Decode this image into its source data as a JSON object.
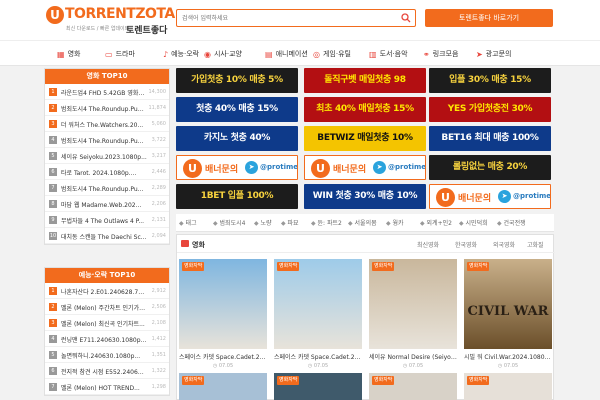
{
  "header": {
    "logo_mark": "U",
    "logo_text": "TORRENTZOTA",
    "logo_subtitle": "최신 다운로드 / 빠른 업데이트",
    "logo_korean": "토렌트좋다",
    "search_placeholder": "검색어 입력하세요",
    "cta_label": "토렌트좋다 바로가기"
  },
  "nav": [
    {
      "icon": "home-icon",
      "glyph": "▦",
      "label": "영화"
    },
    {
      "icon": "tv-icon",
      "glyph": "▭",
      "label": "드라마"
    },
    {
      "icon": "music-icon",
      "glyph": "♪",
      "label": "예능·오락"
    },
    {
      "icon": "camera-icon",
      "glyph": "◉",
      "label": "시사·교양"
    },
    {
      "icon": "list-icon",
      "glyph": "▤",
      "label": "애니메이션"
    },
    {
      "icon": "game-icon",
      "glyph": "◎",
      "label": "게임·유틸"
    },
    {
      "icon": "book-icon",
      "glyph": "▥",
      "label": "도서·음악"
    },
    {
      "icon": "link-icon",
      "glyph": "⚭",
      "label": "링크모음"
    },
    {
      "icon": "telegram-icon",
      "glyph": "➤",
      "label": "광고문의"
    }
  ],
  "sidebar_movies": {
    "title": "영화 TOP10",
    "items": [
      {
        "rank": "1",
        "title": "라운드업4 FHD 5.42GB 영화토렌트",
        "count": "14,300"
      },
      {
        "rank": "2",
        "title": "범죄도시4 The.Roundup.Pun...",
        "count": "11,874"
      },
      {
        "rank": "3",
        "title": "더 워처스 The.Watchers.20...",
        "count": "5,060"
      },
      {
        "rank": "4",
        "title": "범죄도시4 The.Roundup.Pu...",
        "count": "3,722"
      },
      {
        "rank": "5",
        "title": "세이유 Seiyoku.2023.1080p...",
        "count": "3,217"
      },
      {
        "rank": "6",
        "title": "타로 Tarot. 2024.1080p....",
        "count": "2,446"
      },
      {
        "rank": "7",
        "title": "범죄도시4 The.Roundup.Pu...",
        "count": "2,289"
      },
      {
        "rank": "8",
        "title": "마담 웹 Madame.Web.202...",
        "count": "2,206"
      },
      {
        "rank": "9",
        "title": "무법자들 4 The Outlaws 4 P...",
        "count": "2,131"
      },
      {
        "rank": "10",
        "title": "대치동 스캔들 The Daechi Sc...",
        "count": "2,094"
      }
    ]
  },
  "sidebar_shows": {
    "title": "예능·오락 TOP10",
    "items": [
      {
        "rank": "1",
        "title": "나혼자산다 2.E01.240628.72...",
        "count": "2,912"
      },
      {
        "rank": "2",
        "title": "멜론 (Melon) 주간차트 인기가요...",
        "count": "2,506"
      },
      {
        "rank": "3",
        "title": "멜론 (Melon) 최신곡 인기차트...",
        "count": "2,108"
      },
      {
        "rank": "4",
        "title": "런닝맨 E711.240630.1080p...",
        "count": "1,412"
      },
      {
        "rank": "5",
        "title": "놀면뭐하니.240630.1080p...",
        "count": "1,351"
      },
      {
        "rank": "6",
        "title": "전지적 참견 시점 E552.240628.7...",
        "count": "1,322"
      },
      {
        "rank": "7",
        "title": "멜론 (Melon) HOT TREND...",
        "count": "1,298"
      }
    ]
  },
  "banners": [
    {
      "style": "bn-dark",
      "text": "가입첫충 10% 매충 5%"
    },
    {
      "style": "bn-red",
      "text": "돌직구벳 매일첫충 98"
    },
    {
      "style": "bn-dark",
      "text": "입플 30% 매충 15%"
    },
    {
      "style": "bn-blue",
      "text": "첫충 40% 매충 15%"
    },
    {
      "style": "bn-red",
      "text": "최초 40% 매일첫충 15%"
    },
    {
      "style": "bn-red",
      "text": "YES 가입첫충전 30%"
    },
    {
      "style": "bn-blue",
      "text": "카지노 첫충 40%"
    },
    {
      "style": "bn-yellow",
      "text": "BETWIZ 매일첫충 10%"
    },
    {
      "style": "bn-blue",
      "text": "BET16 최대 매충 100%"
    },
    {
      "style": "bn-white",
      "text": "배너문의 @protime1"
    },
    {
      "style": "bn-white",
      "text": "배너문의 @protime1"
    },
    {
      "style": "bn-dark",
      "text": "롤링없는 매충 20%"
    },
    {
      "style": "bn-dark",
      "text": "1BET 입플 100%"
    },
    {
      "style": "bn-blue",
      "text": "WIN 첫충 30% 매충 10%"
    },
    {
      "style": "bn-white",
      "text": "배너문의 @protime1"
    }
  ],
  "tags": [
    "태그",
    "범죄도시4",
    "노량",
    "파묘",
    "듄: 파트2",
    "서울의봄",
    "웡카",
    "외계+인2",
    "시민덕희",
    "건국전쟁"
  ],
  "main": {
    "title": "영화",
    "tabs": [
      "최신영화",
      "한국영화",
      "외국영화",
      "고화질"
    ],
    "cards": [
      {
        "badge": "영화자막",
        "title": "스페이스 카뎃 Space.Cadet.2024.1...",
        "date": "07.05",
        "bg": "#7fb6e0"
      },
      {
        "badge": "영화자막",
        "title": "스페이스 카뎃 Space.Cadet.2024.1...",
        "date": "07.05",
        "bg": "#9ecbe9"
      },
      {
        "badge": "영화자막",
        "title": "세이유 Normal Desire (Seiyoku) ...",
        "date": "07.05",
        "bg": "#c9b79c"
      },
      {
        "badge": "영화자막",
        "title": "시빌 워 Civil.War.2024.1080p.Bl...",
        "date": "07.05",
        "bg": "#c9b08a"
      }
    ],
    "cards2": [
      {
        "badge": "영화자막",
        "bg": "#a7c0d6"
      },
      {
        "badge": "영화자막",
        "bg": "#3f5a6b"
      },
      {
        "badge": "영화자막",
        "bg": "#d8d2c8"
      },
      {
        "badge": "영화자막",
        "bg": "#e6e0d8"
      }
    ]
  }
}
